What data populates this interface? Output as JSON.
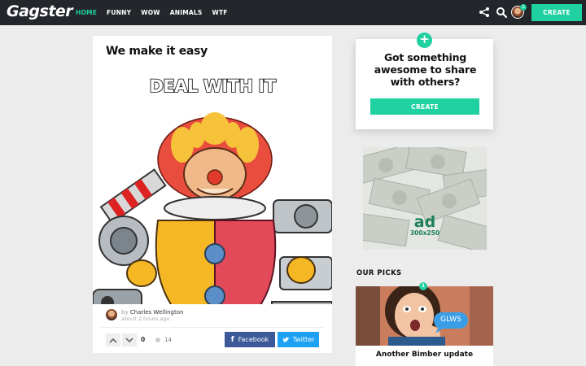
{
  "header": {
    "logo": "Gagster",
    "nav": [
      "HOME",
      "FUNNY",
      "WOW",
      "ANIMALS",
      "WTF"
    ],
    "avatar_badge": "1",
    "create_label": "CREATE"
  },
  "post": {
    "title": "We make it easy",
    "image_caption": "DEAL WITH IT",
    "author_by": "by ",
    "author_name": "Charles Wellington",
    "time_ago": "about 2 hours ago",
    "vote_count": "0",
    "comment_count": "14",
    "facebook_label": "Facebook",
    "twitter_label": "Twitter"
  },
  "sidebar": {
    "cta_text": "Got something awesome to share with others?",
    "cta_button": "CREATE",
    "ad_text": "ad",
    "ad_size": "300x250",
    "picks_heading": "OUR PICKS",
    "pick_badge": "1",
    "pick_bubble": "GLWS",
    "pick_title": "Another Bimber update"
  },
  "colors": {
    "accent": "#1fd1a0",
    "topbar": "#23262b",
    "facebook": "#3b5998",
    "twitter": "#1da1f2"
  }
}
